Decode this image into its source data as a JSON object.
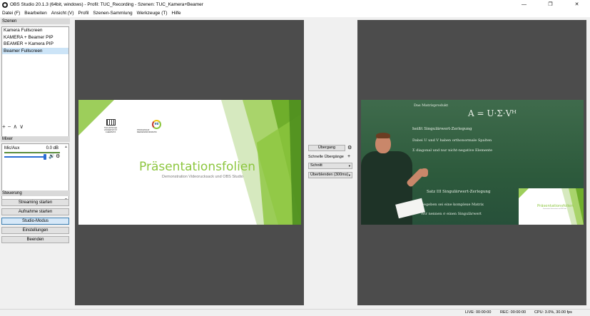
{
  "window": {
    "title": "OBS Studio 20.1.3 (64bit, windows) - Profil: TUC_Recording - Szenen: TUC_Kamera+Beamer",
    "controls": [
      "—",
      "❐",
      "✕"
    ]
  },
  "menu": [
    "Datei (F)",
    "Bearbeiten",
    "Ansicht (V)",
    "Profil",
    "Szenen-Sammlung",
    "Werkzeuge (T)",
    "Hilfe"
  ],
  "scenes": {
    "title": "Szenen",
    "items": [
      "Kamera Fullscreen",
      "KAMERA + Beamer PIP",
      "BEAMER + Kamera PIP",
      "Beamer Fullscreen"
    ],
    "selected_index": 3,
    "toolbar": [
      "+",
      "−",
      "∧",
      "∨"
    ]
  },
  "mixer": {
    "title": "Mixer",
    "source": "Mic/Aux",
    "level": "0.0 dB",
    "volume_fraction": 1.0
  },
  "controls": {
    "title": "Steuerung",
    "buttons": [
      "Streaming starten",
      "Aufnahme starten",
      "Studio-Modus",
      "Einstellungen",
      "Beenden"
    ]
  },
  "transitions": {
    "transition_button": "Übergang",
    "quick_label": "Schnelle Übergänge",
    "cut": "Schnitt",
    "fade": "Überblenden (300ms)"
  },
  "preview_slide": {
    "title": "Präsentationsfolien",
    "subtitle": "Demonstration Videorucksack und OBS Studio",
    "tu_logo_text": "TECHNISCHE UNIVERSITÄT CHEMNITZ",
    "mi_logo_text": "PROFESSUR MEDIENINFORMATIK",
    "mi_mark": "mi"
  },
  "program_scene": {
    "pip_title": "Präsentationsfolien",
    "pip_subtitle": "Demonstration Videorucksack und OBS Studio",
    "chalk_lines": [
      "Das Matrixprodukt",
      "A = U·Σ·Vᴴ",
      "heißt Singulärwert-Zerlegung",
      "Dabei U und V haben orthonormale Spalten",
      "Σ diagonal und nur nicht-negative Elemente",
      "Satz III Singulärwert-Zerlegung",
      "Gegeben sei eine komplexe Matrix",
      "Wir nennen σ einen Singulärwert"
    ]
  },
  "status": {
    "live": "LIVE: 00:00:00",
    "rec": "REC: 00:00:00",
    "cpu": "CPU: 3.0%, 30.00 fps"
  },
  "colors": {
    "accent_green": "#8cc63e",
    "canvas_gray": "#4c4c4c",
    "selection": "#cce4f7"
  }
}
